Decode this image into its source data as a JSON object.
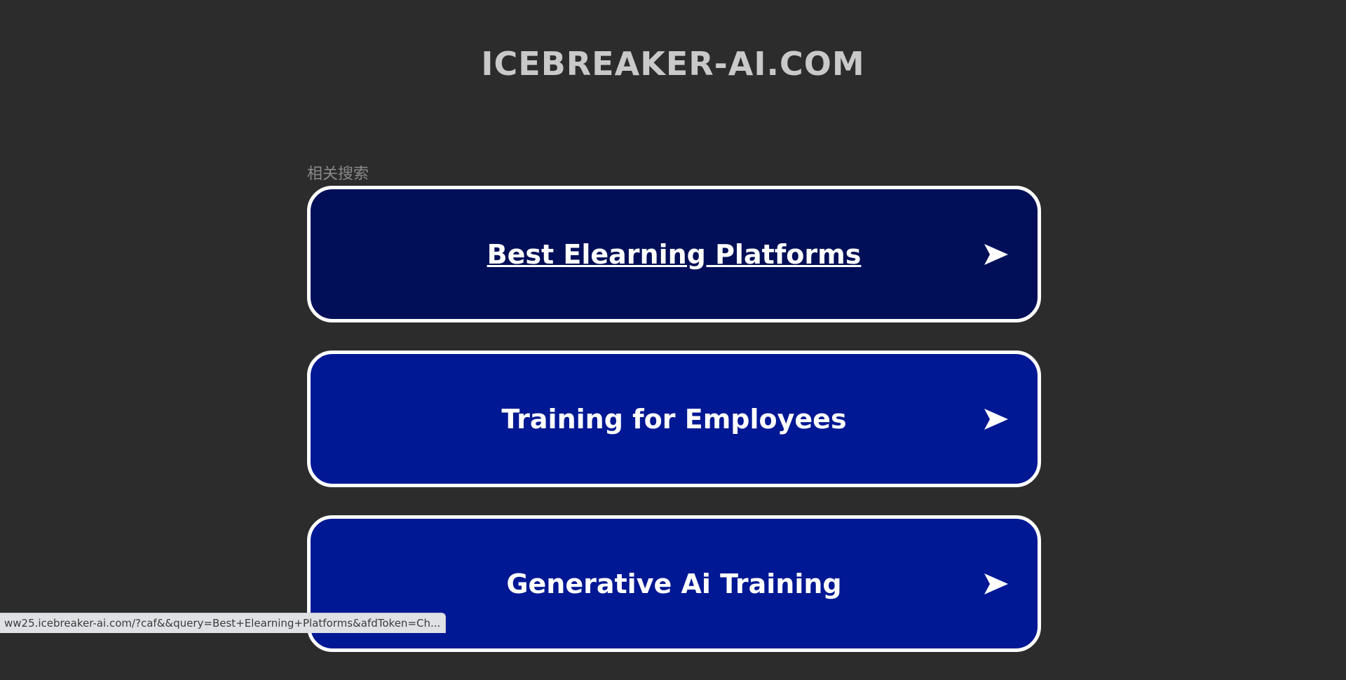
{
  "header": {
    "site_title": "ICEBREAKER-AI.COM"
  },
  "related": {
    "label": "相关搜索",
    "items": [
      {
        "label": "Best Elearning Platforms",
        "visited": true
      },
      {
        "label": "Training for Employees",
        "visited": false
      },
      {
        "label": "Generative Ai Training",
        "visited": false
      }
    ],
    "arrow_icon": "arrow-right-icon"
  },
  "status_bar": {
    "url": "ww25.icebreaker-ai.com/?caf&&query=Best+Elearning+Platforms&afdToken=Ch..."
  },
  "colors": {
    "background": "#2c2c2c",
    "title": "#c9c9c9",
    "button_visited": "#000f58",
    "button": "#001893",
    "button_border": "#ffffff"
  }
}
